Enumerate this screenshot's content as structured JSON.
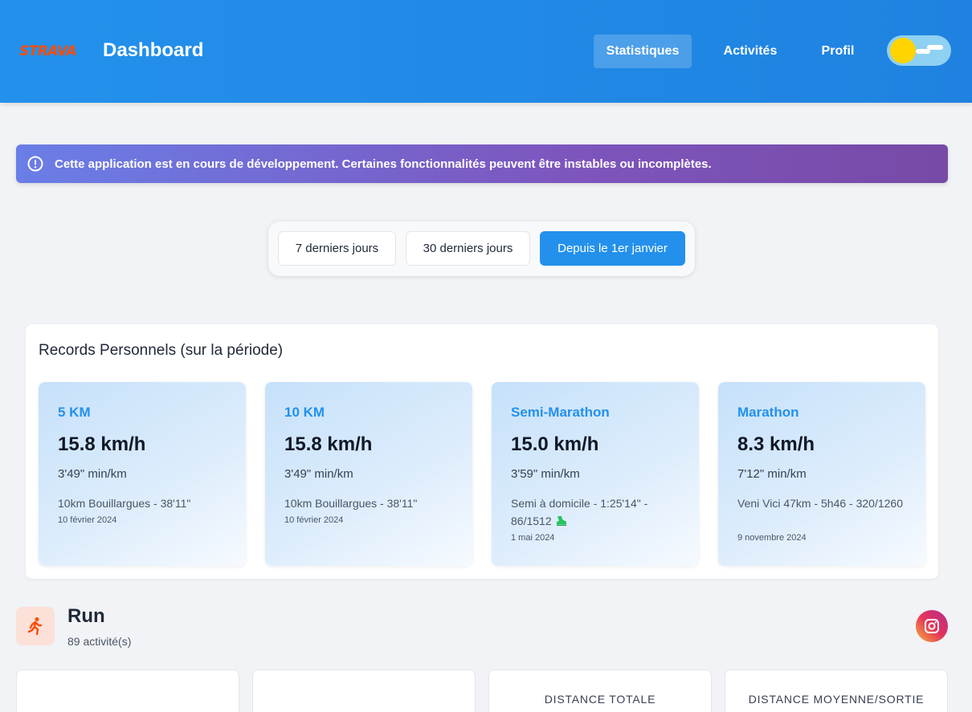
{
  "header": {
    "logo": "STRAVA",
    "title": "Dashboard",
    "nav": [
      {
        "label": "Statistiques",
        "active": true
      },
      {
        "label": "Activités",
        "active": false
      },
      {
        "label": "Profil",
        "active": false
      }
    ],
    "theme_toggle": {
      "state": "light",
      "icon": "sun-icon"
    }
  },
  "banner": {
    "icon": "info-icon",
    "text": "Cette application est en cours de développement. Certaines fonctionnalités peuvent être instables ou incomplètes."
  },
  "period": {
    "options": [
      {
        "label": "7 derniers jours",
        "active": false
      },
      {
        "label": "30 derniers jours",
        "active": false
      },
      {
        "label": "Depuis le 1er janvier",
        "active": true
      }
    ]
  },
  "records": {
    "title": "Records Personnels (sur la période)",
    "items": [
      {
        "name": "5 KM",
        "speed": "15.8 km/h",
        "pace": "3'49\" min/km",
        "activity": "10km Bouillargues - 38'11\"",
        "date": "10 février 2024"
      },
      {
        "name": "10 KM",
        "speed": "15.8 km/h",
        "pace": "3'49\" min/km",
        "activity": "10km Bouillargues - 38'11\"",
        "date": "10 février 2024"
      },
      {
        "name": "Semi-Marathon",
        "speed": "15.0 km/h",
        "pace": "3'59\" min/km",
        "activity": "Semi à domicile - 1:25'14\" - 86/1512",
        "activity_icon": "shoe-icon",
        "date": "1 mai 2024"
      },
      {
        "name": "Marathon",
        "speed": "8.3 km/h",
        "pace": "7'12\" min/km",
        "activity": "Veni Vici 47km - 5h46 - 320/1260",
        "date": "9 novembre 2024"
      }
    ]
  },
  "run": {
    "icon": "running-icon",
    "title": "Run",
    "count": "89 activité(s)",
    "share_icon": "instagram-icon",
    "stats": [
      {
        "label": ""
      },
      {
        "label": ""
      },
      {
        "label": "DISTANCE TOTALE"
      },
      {
        "label": "DISTANCE MOYENNE/SORTIE"
      }
    ]
  },
  "colors": {
    "header": "#2391ec",
    "accent": "#2391ec",
    "strava_orange": "#fc4c02",
    "banner_start": "#6a7ee7",
    "banner_end": "#774aa6"
  }
}
